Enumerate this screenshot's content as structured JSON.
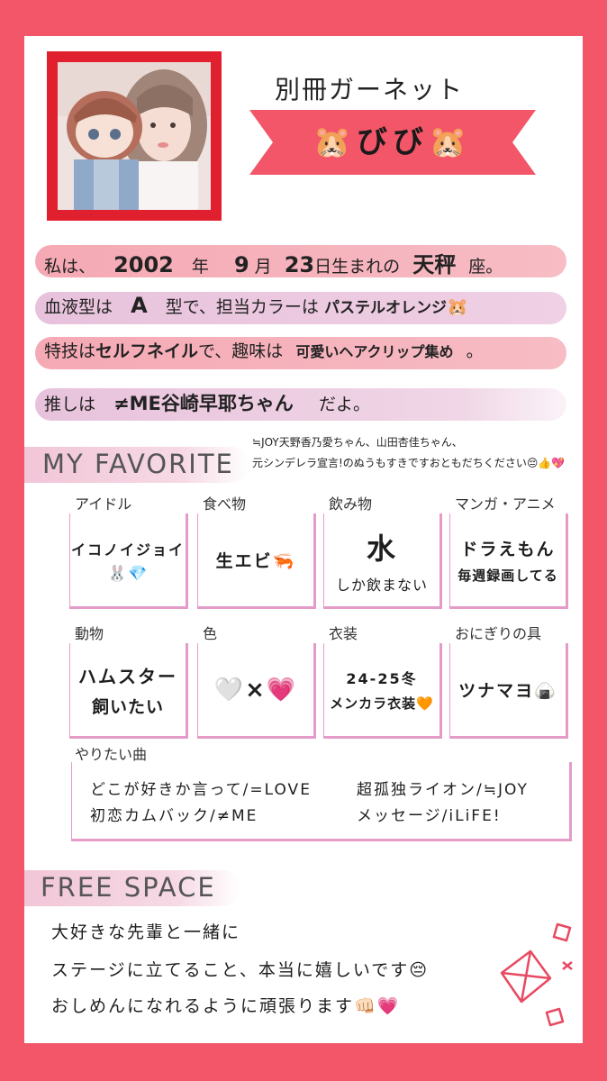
{
  "header": {
    "group": "別冊ガーネット",
    "name": "びび",
    "name_emoji": "🐹"
  },
  "intro": {
    "line1_a": "私は、",
    "year": "2002",
    "line1_b": "年",
    "month": "9",
    "line1_c": "月",
    "day": "23",
    "line1_d": "日生まれの",
    "zodiac": "天秤",
    "line1_e": "座。",
    "line2_a": "血液型は",
    "blood": "A",
    "line2_b": "型で、担当カラーは",
    "color": "パステルオレンジ",
    "color_emoji": "🐹",
    "line3_a": "特技は",
    "skill": "セルフネイル",
    "line3_b": "で、趣味は",
    "hobby": "可愛いヘアクリップ集め",
    "line3_c": "。",
    "line4_a": "推しは",
    "oshi": "≠ME谷崎早耶ちゃん",
    "line4_b": "だよ。"
  },
  "favorite": {
    "title": "MY FAVORITE",
    "note1": "≒JOY天野香乃愛ちゃん、山田杏佳ちゃん、",
    "note2": "元シンデレラ宣言!のぬうもすきですおともだちください😔👍💖",
    "items": [
      {
        "category": "アイドル",
        "value": "イコノイジョイ",
        "sub": "🐰💎"
      },
      {
        "category": "食べ物",
        "value": "生エビ🦐",
        "sub": ""
      },
      {
        "category": "飲み物",
        "value": "水",
        "sub": "しか飲まない"
      },
      {
        "category": "マンガ・アニメ",
        "value": "ドラえもん",
        "sub": "毎週録画してる"
      },
      {
        "category": "動物",
        "value": "ハムスター",
        "sub": "飼いたい"
      },
      {
        "category": "色",
        "value": "🤍×💗",
        "sub": ""
      },
      {
        "category": "衣装",
        "value": "24-25冬",
        "sub": "メンカラ衣装🧡"
      },
      {
        "category": "おにぎりの具",
        "value": "ツナマヨ🍙",
        "sub": ""
      }
    ],
    "songs_label": "やりたい曲",
    "songs": [
      "どこが好きか言って/=LOVE",
      "初恋カムバック/≠ME",
      "超孤独ライオン/≒JOY",
      "メッセージ/iLiFE!"
    ]
  },
  "free_space": {
    "title": "FREE SPACE",
    "lines": [
      "大好きな先輩と一緒に",
      "ステージに立てること、本当に嬉しいです😔",
      "おしめんになれるように頑張ります👊🏻💗"
    ]
  }
}
